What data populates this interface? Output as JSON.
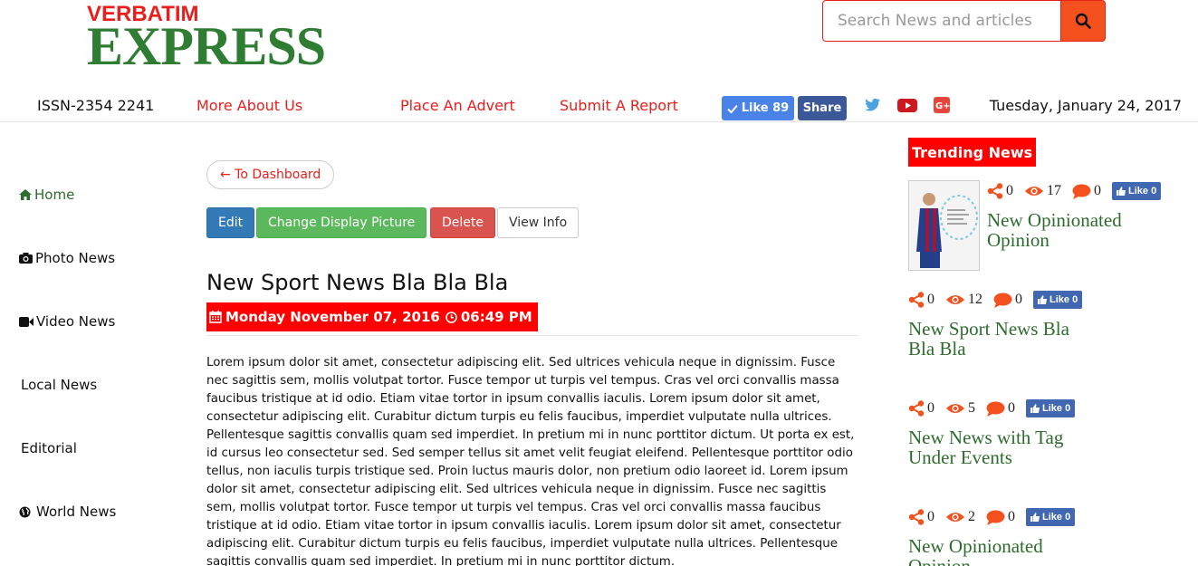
{
  "header": {
    "logo_top": "VERBATIM",
    "logo_main": "EXPRESS",
    "search_placeholder": "Search News and articles",
    "issn": "ISSN-2354 2241",
    "links": [
      "More About Us",
      "Place An Advert",
      "Submit A Report"
    ],
    "fb_like_label": "Like 89",
    "fb_share_label": "Share",
    "date": "Tuesday, January 24, 2017"
  },
  "sidebar": {
    "items": [
      {
        "label": "Home",
        "icon": "home-icon"
      },
      {
        "label": "Photo News",
        "icon": "camera-icon"
      },
      {
        "label": "Video News",
        "icon": "video-icon"
      },
      {
        "label": "Local News",
        "icon": ""
      },
      {
        "label": "Editorial",
        "icon": ""
      },
      {
        "label": "World News",
        "icon": "globe-icon"
      }
    ]
  },
  "main": {
    "back_label": "← To Dashboard",
    "buttons": {
      "edit": "Edit",
      "change_picture": "Change Display Picture",
      "delete": "Delete",
      "view_info": "View Info"
    },
    "title": "New Sport News Bla Bla Bla",
    "date": "Monday November 07, 2016",
    "time": "06:49 PM",
    "body": "Lorem ipsum dolor sit amet, consectetur adipiscing elit. Sed ultrices vehicula neque in dignissim. Fusce nec sagittis sem, mollis volutpat tortor. Fusce tempor ut turpis vel tempus. Cras vel orci convallis massa faucibus tristique at id odio. Etiam vitae tortor in ipsum convallis iaculis. Lorem ipsum dolor sit amet, consectetur adipiscing elit. Curabitur dictum turpis eu felis faucibus, imperdiet vulputate nulla ultrices. Pellentesque sagittis convallis quam sed imperdiet. In pretium mi in nunc porttitor dictum. Ut porta ex est, id cursus leo consectetur sed. Sed semper tellus sit amet velit feugiat eleifend. Pellentesque porttitor odio tellus, non iaculis turpis tristique sed. Proin luctus mauris dolor, non pretium odio laoreet id. Lorem ipsum dolor sit amet, consectetur adipiscing elit. Sed ultrices vehicula neque in dignissim. Fusce nec sagittis sem, mollis volutpat tortor. Fusce tempor ut turpis vel tempus. Cras vel orci convallis massa faucibus tristique at id odio. Etiam vitae tortor in ipsum convallis iaculis. Lorem ipsum dolor sit amet, consectetur adipiscing elit. Curabitur dictum turpis eu felis faucibus, imperdiet vulputate nulla ultrices. Pellentesque sagittis convallis quam sed imperdiet. In pretium mi in nunc porttitor dictum."
  },
  "trending": {
    "heading": "Trending News",
    "items": [
      {
        "shares": "0",
        "views": "17",
        "comments": "0",
        "like": "Like 0",
        "title": "New Opinionated Opinion"
      },
      {
        "shares": "0",
        "views": "12",
        "comments": "0",
        "like": "Like 0",
        "title": "New Sport News Bla Bla Bla"
      },
      {
        "shares": "0",
        "views": "5",
        "comments": "0",
        "like": "Like 0",
        "title": "New News with Tag Under Events"
      },
      {
        "shares": "0",
        "views": "2",
        "comments": "0",
        "like": "Like 0",
        "title": "New Opinionated Opinion"
      }
    ]
  },
  "colors": {
    "brand_red": "#e8201d",
    "brand_green": "#2e7d32",
    "accent_orange": "#f4511e"
  }
}
